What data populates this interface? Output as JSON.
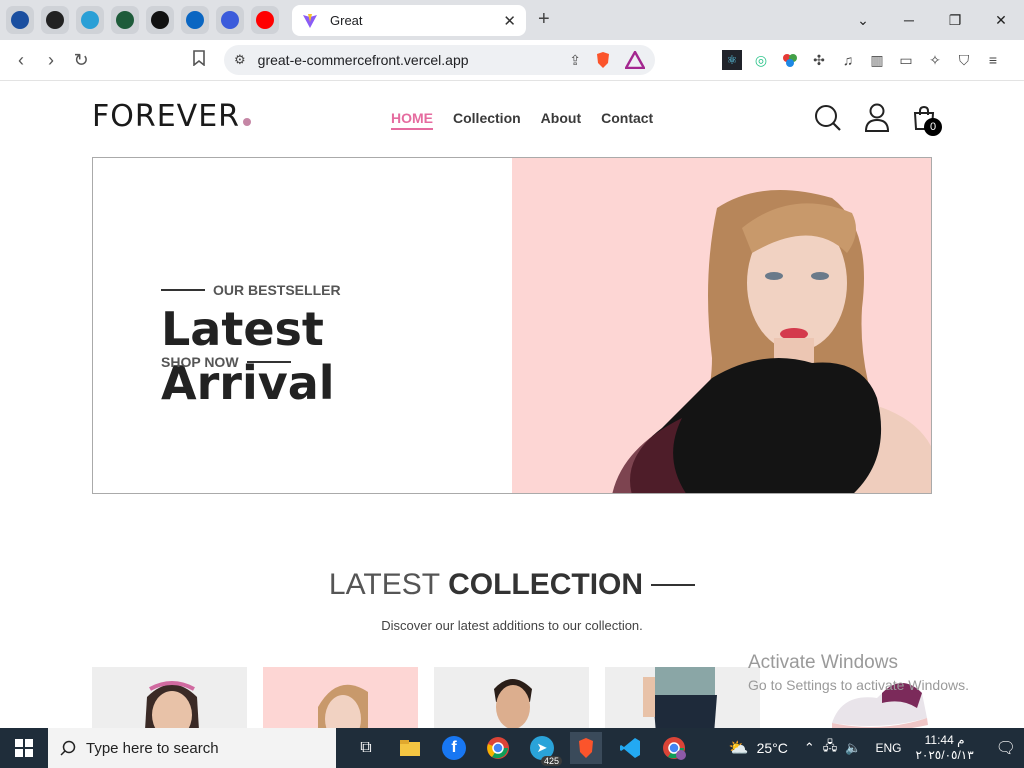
{
  "browser": {
    "pinned_tabs": [
      {
        "icon": "paypal-icon",
        "color": "#1b4fa0"
      },
      {
        "icon": "upwork-icon",
        "color": "#222222"
      },
      {
        "icon": "circle-app-icon",
        "color": "#2a9fd6"
      },
      {
        "icon": "dark-app-icon",
        "color": "#1e5b3a"
      },
      {
        "icon": "github-icon",
        "color": "#111111"
      },
      {
        "icon": "linkedin-icon",
        "color": "#0a66c2"
      },
      {
        "icon": "blue-app-icon",
        "color": "#3b5bdb"
      },
      {
        "icon": "youtube-icon",
        "color": "#ff0000"
      }
    ],
    "active_tab_title": "Great",
    "url": "great-e-commercefront.vercel.app"
  },
  "site": {
    "logo_text": "FOREVER",
    "nav": [
      "HOME",
      "Collection",
      "About",
      "Contact"
    ],
    "active_nav": "HOME",
    "cart_count": "0",
    "hero": {
      "eyebrow": "OUR BESTSELLER",
      "headline": "Latest Arrival",
      "cta": "SHOP NOW",
      "bg_color": "#fdd6d4"
    },
    "latest": {
      "title_light": "LATEST",
      "title_bold": "COLLECTION",
      "subtitle": "Discover our latest additions to our collection."
    },
    "accent_color": "#e56b9f"
  },
  "watermark": {
    "line1": "Activate Windows",
    "line2": "Go to Settings to activate Windows."
  },
  "taskbar": {
    "search_placeholder": "Type here to search",
    "telegram_badge": "425",
    "weather": "25°C",
    "language": "ENG",
    "time": "11:44 م",
    "date": "٢٠٢٥/٠٥/١٣"
  }
}
